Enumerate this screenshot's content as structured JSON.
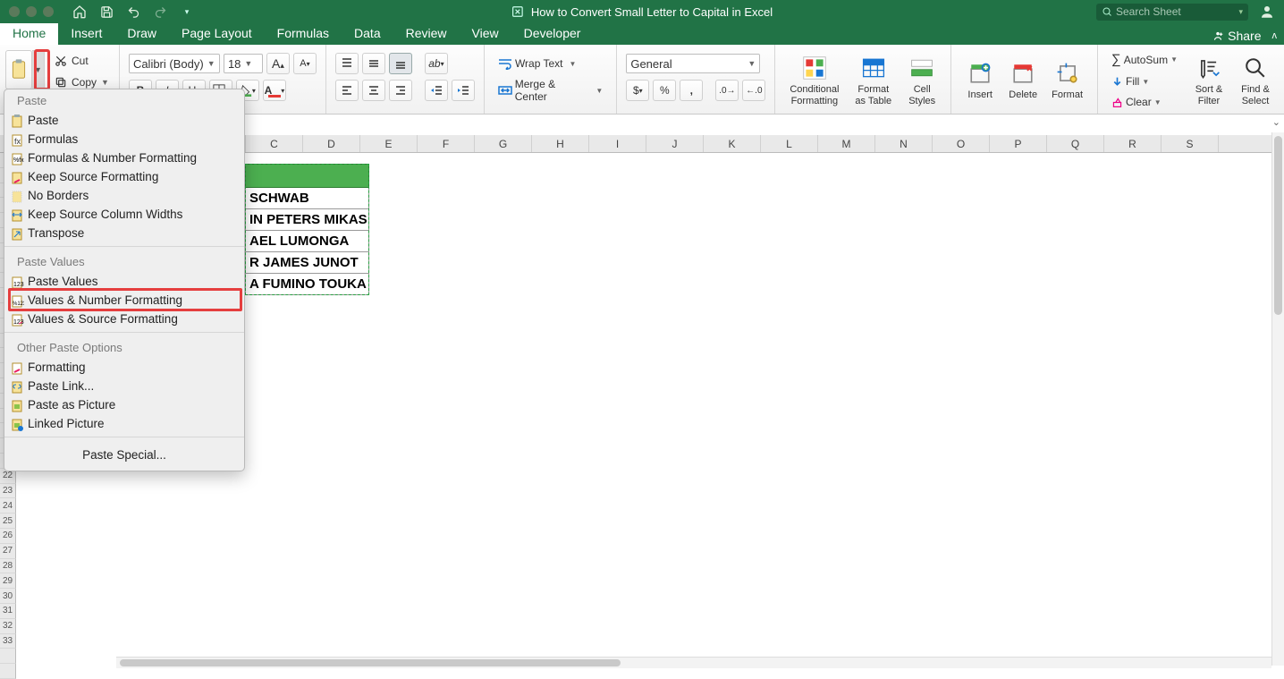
{
  "titlebar": {
    "doc_title": "How to Convert Small Letter to Capital in Excel",
    "search_placeholder": "Search Sheet"
  },
  "tabs": {
    "items": [
      "Home",
      "Insert",
      "Draw",
      "Page Layout",
      "Formulas",
      "Data",
      "Review",
      "View",
      "Developer"
    ],
    "active": "Home",
    "share_label": "Share"
  },
  "ribbon": {
    "clipboard": {
      "cut": "Cut",
      "copy": "Copy"
    },
    "font": {
      "name": "Calibri (Body)",
      "size": "18"
    },
    "alignment": {
      "wrap": "Wrap Text",
      "merge": "Merge & Center"
    },
    "number": {
      "format": "General"
    },
    "styles": {
      "cond": "Conditional\nFormatting",
      "fmt": "Format\nas Table",
      "cell": "Cell\nStyles"
    },
    "cells": {
      "insert": "Insert",
      "delete": "Delete",
      "format": "Format"
    },
    "editing": {
      "autosum": "AutoSum",
      "fill": "Fill",
      "clear": "Clear",
      "sort": "Sort &\nFilter",
      "find": "Find &\nSelect"
    }
  },
  "paste_menu": {
    "hdr1": "Paste",
    "items1": [
      "Paste",
      "Formulas",
      "Formulas & Number Formatting",
      "Keep Source Formatting",
      "No Borders",
      "Keep Source Column Widths",
      "Transpose"
    ],
    "hdr2": "Paste Values",
    "items2": [
      "Paste Values",
      "Values & Number Formatting",
      "Values & Source Formatting"
    ],
    "hdr3": "Other Paste Options",
    "items3": [
      "Formatting",
      "Paste Link...",
      "Paste as Picture",
      "Linked Picture"
    ],
    "special": "Paste Special..."
  },
  "grid": {
    "cols": [
      "C",
      "D",
      "E",
      "F",
      "G",
      "H",
      "I",
      "J",
      "K",
      "L",
      "M",
      "N",
      "O",
      "P",
      "Q",
      "R",
      "S"
    ],
    "rows_start": 22,
    "rows_end": 33,
    "data_cells": [
      " SCHWAB",
      "IN PETERS MIKAS",
      "AEL LUMONGA",
      "R JAMES JUNOT",
      "A FUMINO TOUKA"
    ]
  }
}
